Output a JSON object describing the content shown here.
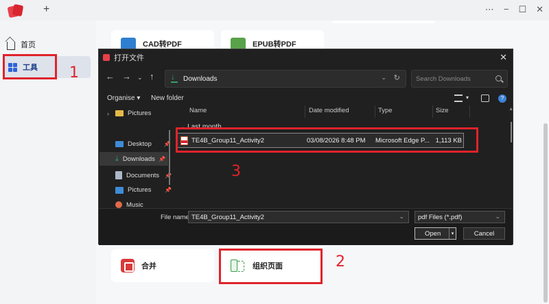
{
  "app": {
    "sidebar": {
      "home_label": "首页",
      "tools_label": "工具"
    },
    "cards": {
      "cad_label": "CAD转PDF",
      "epub_label": "EPUB转PDF",
      "merge_label": "合并",
      "organize_label": "组织页面"
    }
  },
  "dialog": {
    "title": "打开文件",
    "close_symbol": "✕",
    "address": "Downloads",
    "search_placeholder": "Search Downloads",
    "toolbar": {
      "organise": "Organise ▾",
      "new_folder": "New folder"
    },
    "nav_items": [
      {
        "label": "Pictures",
        "icon": "folder-icon"
      },
      {
        "label": "Desktop",
        "icon": "desktop-icon"
      },
      {
        "label": "Downloads",
        "icon": "download-icon"
      },
      {
        "label": "Documents",
        "icon": "documents-icon"
      },
      {
        "label": "Pictures",
        "icon": "pictures-icon"
      },
      {
        "label": "Music",
        "icon": "music-icon"
      }
    ],
    "columns": {
      "name": "Name",
      "date": "Date modified",
      "type": "Type",
      "size": "Size"
    },
    "group_header": "Last month",
    "files": [
      {
        "name": "TE4B_Group11_Activity2",
        "date": "03/08/2026 8:48 PM",
        "type": "Microsoft Edge P...",
        "size": "1,113 KB"
      }
    ],
    "file_name_label": "File name:",
    "file_name_value": "TE4B_Group11_Activity2",
    "file_type": "pdf Files (*.pdf)",
    "open_label": "Open",
    "cancel_label": "Cancel"
  },
  "annotations": {
    "step1": "1",
    "step2": "2",
    "step3": "3",
    "color": "#e0232b"
  }
}
